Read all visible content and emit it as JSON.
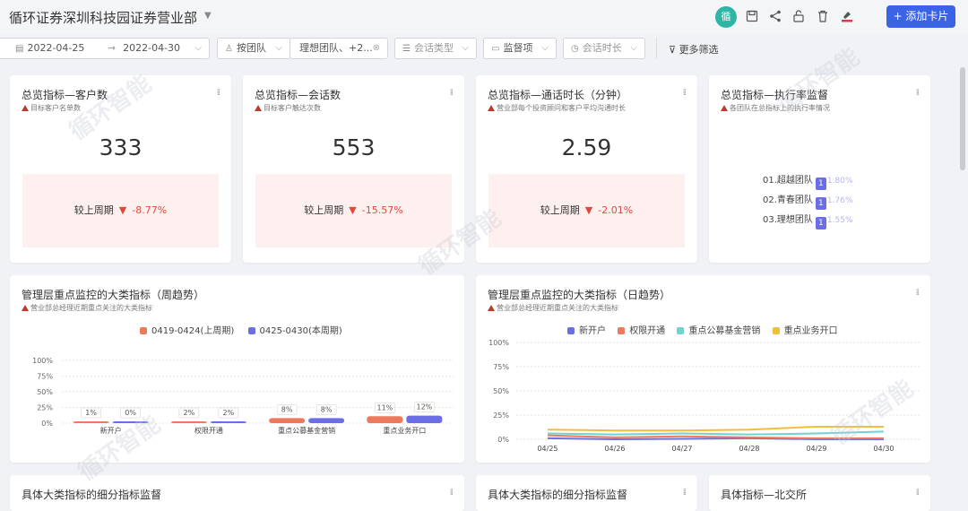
{
  "header": {
    "title": "循环证券深圳科技园证券营业部",
    "avatar": "循",
    "add_label": "+ 添加卡片"
  },
  "filters": {
    "date_from": "2022-04-25",
    "date_to": "2022-04-30",
    "team_by": "按团队",
    "teams": "理想团队、+2...",
    "session_type": "会话类型",
    "supervision": "监督项",
    "duration": "会话时长",
    "more": "更多筛选"
  },
  "cards": [
    {
      "title": "总览指标—客户数",
      "sub": "目标客户名单数",
      "value": "333",
      "cmp_label": "较上周期",
      "cmp": "-8.77%"
    },
    {
      "title": "总览指标—会话数",
      "sub": "目标客户触达次数",
      "value": "553",
      "cmp_label": "较上周期",
      "cmp": "-15.57%"
    },
    {
      "title": "总览指标—通话时长（分钟）",
      "sub": "营业部每个投资顾问和客户平均沟通时长",
      "value": "2.59",
      "cmp_label": "较上周期",
      "cmp": "-2.01%"
    },
    {
      "title": "总览指标—执行率监督",
      "sub": "各团队在总指标上的执行率情况"
    }
  ],
  "exec_rate": {
    "rows": [
      {
        "label": "01.超越团队",
        "value": "1.80%"
      },
      {
        "label": "02.青春团队",
        "value": "1.76%"
      },
      {
        "label": "03.理想团队",
        "value": "1.55%"
      }
    ],
    "bar_color": "#6c6ee6"
  },
  "weekly": {
    "title": "管理层重点监控的大类指标（周趋势）",
    "sub": "营业部总经理近期重点关注的大类指标"
  },
  "daily": {
    "title": "管理层重点监控的大类指标（日趋势）",
    "sub": "营业部总经理近期重点关注的大类指标"
  },
  "bottom": [
    {
      "title": "具体大类指标的细分指标监督"
    },
    {
      "title": "具体大类指标的细分指标监督"
    },
    {
      "title": "具体指标—北交所"
    }
  ],
  "watermark": "循环智能",
  "colors": {
    "accent": "#3b63e6",
    "red": "#e04a3c",
    "series_prev": "#ee7a5e",
    "series_cur": "#6c6ee6",
    "teal": "#6fd3cf",
    "yellow": "#f2be3a"
  },
  "chart_data": [
    {
      "type": "bar",
      "categories": [
        "新开户",
        "权限开通",
        "重点公募基金营销",
        "重点业务开口"
      ],
      "series": [
        {
          "name": "0419-0424(上周期)",
          "values": [
            1,
            2,
            8,
            11
          ],
          "labels": [
            "1%",
            "2%",
            "8%",
            "11%"
          ]
        },
        {
          "name": "0425-0430(本周期)",
          "values": [
            0,
            2,
            8,
            12
          ],
          "labels": [
            "0%",
            "2%",
            "8%",
            "12%"
          ]
        }
      ],
      "ylim": [
        0,
        100
      ],
      "yticks": [
        "100%",
        "75%",
        "50%",
        "25%",
        "0%"
      ],
      "legend": "top"
    },
    {
      "type": "line",
      "x": [
        "04/25",
        "04/26",
        "04/27",
        "04/28",
        "04/29",
        "04/30"
      ],
      "series": [
        {
          "name": "新开户",
          "values": [
            1,
            0,
            0.5,
            1,
            0,
            0
          ]
        },
        {
          "name": "权限开通",
          "values": [
            4,
            2,
            3,
            2,
            1,
            1
          ]
        },
        {
          "name": "重点公募基金营销",
          "values": [
            6,
            5,
            6,
            5,
            6,
            8
          ]
        },
        {
          "name": "重点业务开口",
          "values": [
            10,
            9,
            9,
            10,
            13,
            13
          ]
        }
      ],
      "ylim": [
        0,
        100
      ],
      "yticks": [
        "100%",
        "75%",
        "50%",
        "25%",
        "0%"
      ],
      "legend": "top"
    }
  ]
}
